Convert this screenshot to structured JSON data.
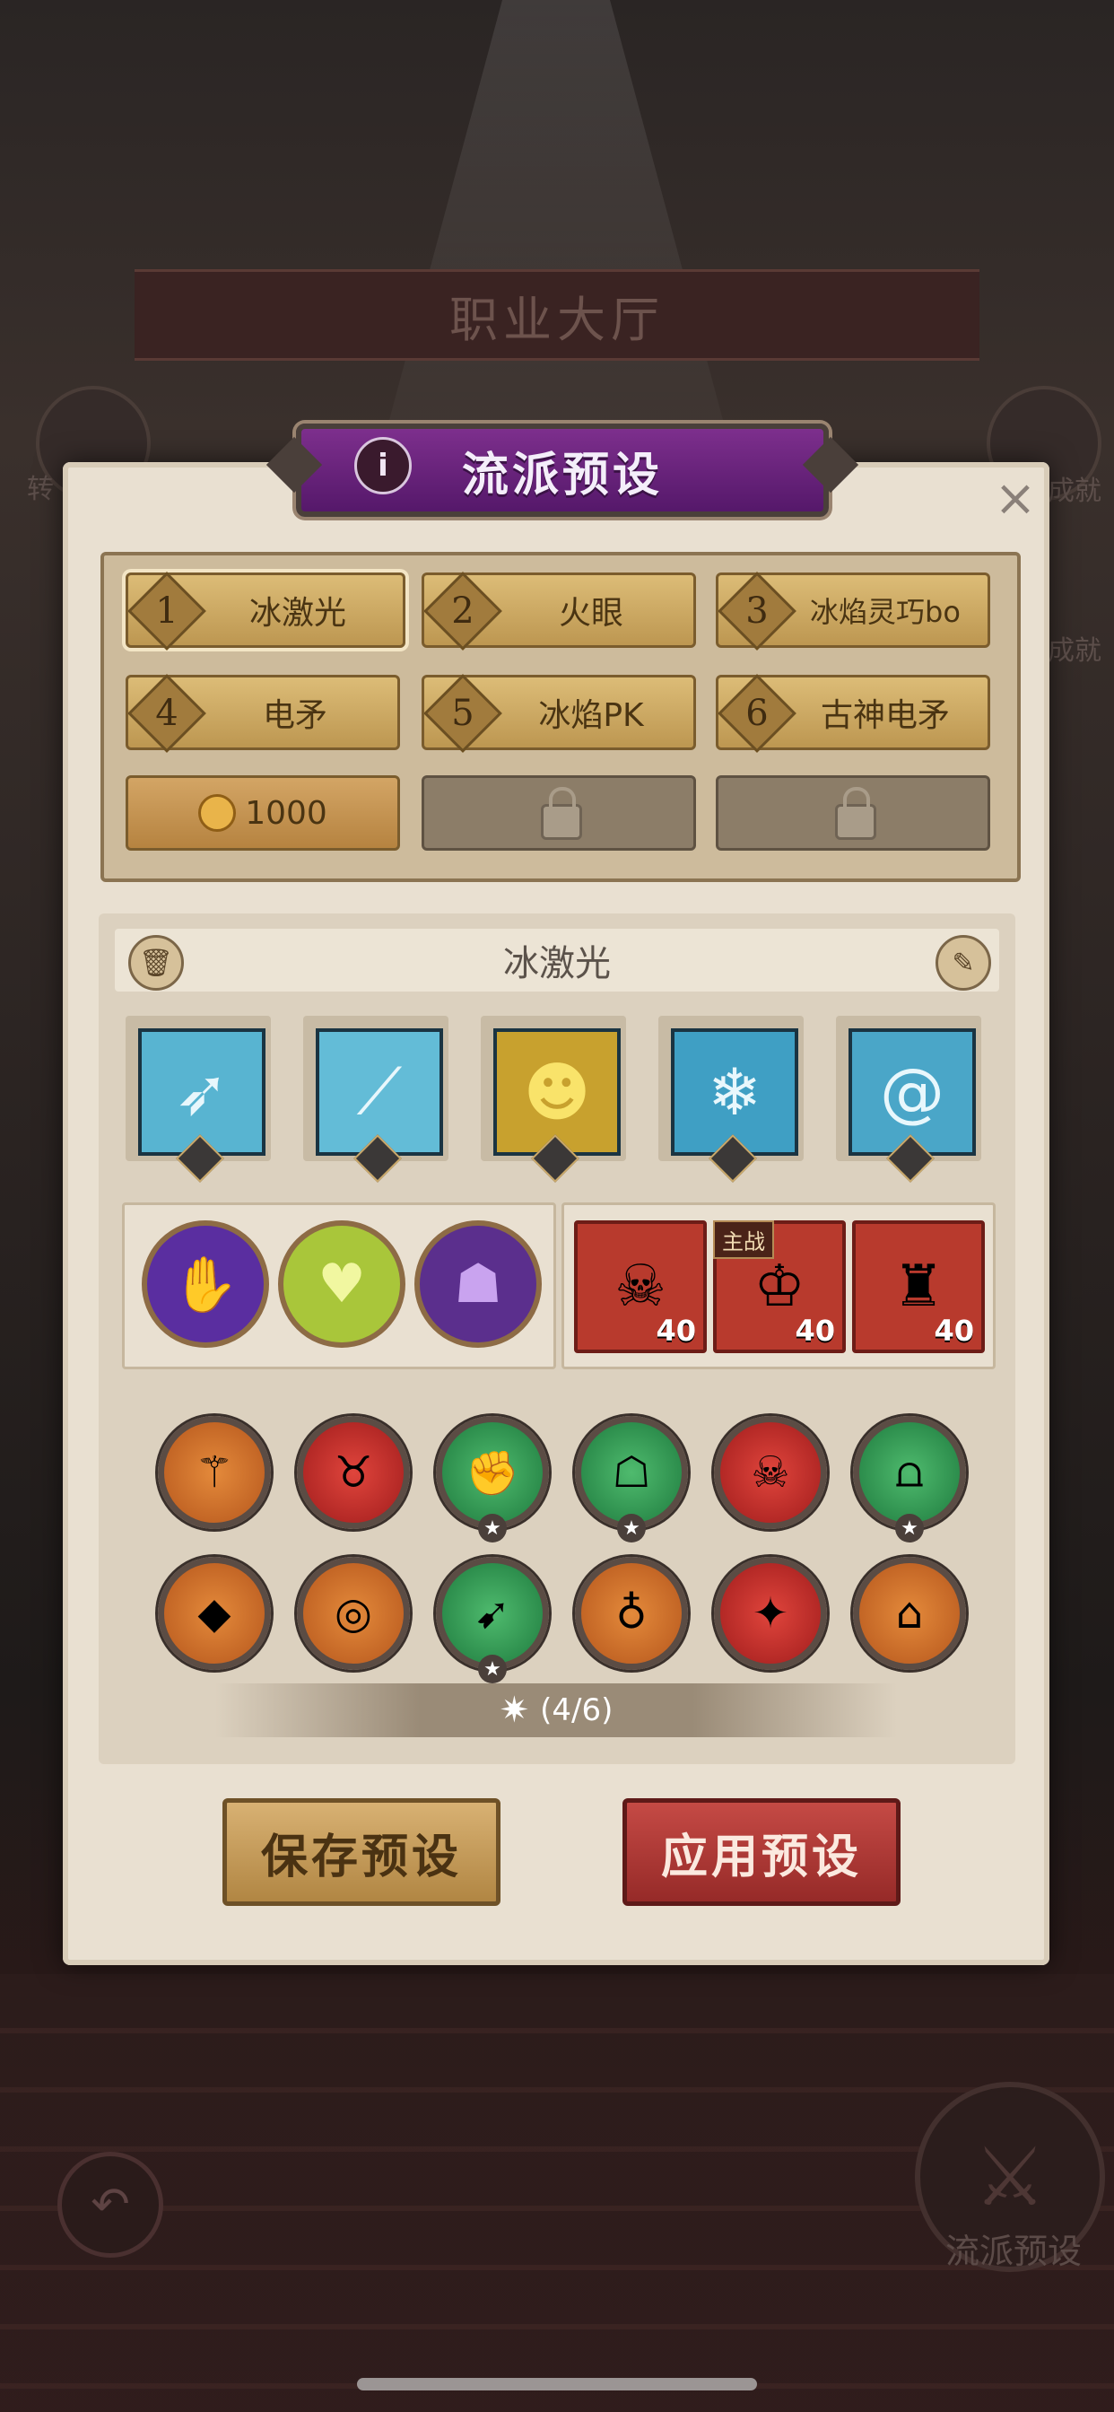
{
  "background": {
    "hall_title": "职业大厅",
    "left_side_label": "转",
    "right_side_labels": [
      "成就",
      "成就"
    ],
    "preset_corner_label": "流派预设"
  },
  "modal": {
    "title": "流派预设",
    "info_icon": "info-icon",
    "close_icon": "close-icon"
  },
  "slots": [
    {
      "num": "1",
      "name": "冰激光",
      "active": true
    },
    {
      "num": "2",
      "name": "火眼"
    },
    {
      "num": "3",
      "name": "冰焰灵巧bo"
    },
    {
      "num": "4",
      "name": "电矛"
    },
    {
      "num": "5",
      "name": "冰焰PK"
    },
    {
      "num": "6",
      "name": "古神电矛"
    }
  ],
  "unlock": {
    "cost": "1000",
    "icon": "coin-icon"
  },
  "locked_slots": 2,
  "preset": {
    "name": "冰激光",
    "delete_icon": "trash-icon",
    "edit_icon": "pencil-icon"
  },
  "skills": [
    {
      "icon": "ice-spear-icon",
      "color": "#58b4d1"
    },
    {
      "icon": "ice-slash-icon",
      "color": "#63bcd7"
    },
    {
      "icon": "golden-figure-icon",
      "color": "#c8a12e"
    },
    {
      "icon": "snowflake-icon",
      "color": "#3f9fc4"
    },
    {
      "icon": "ice-vortex-icon",
      "color": "#4aa6c8"
    }
  ],
  "talents": [
    {
      "icon": "purple-hand-icon",
      "color": "#5a2ea0"
    },
    {
      "icon": "green-heart-icon",
      "color": "#a9c63a"
    },
    {
      "icon": "hooded-figure-icon",
      "color": "#5b2f8d"
    }
  ],
  "heroes": [
    {
      "level": "40",
      "icon": "white-mask-hero-icon"
    },
    {
      "level": "40",
      "icon": "dark-king-hero-icon",
      "tag": "主战"
    },
    {
      "level": "40",
      "icon": "purple-knight-hero-icon"
    }
  ],
  "equipment_row1": [
    {
      "color": "orange",
      "icon": "staff-icon"
    },
    {
      "color": "red",
      "icon": "horned-helm-icon"
    },
    {
      "color": "green",
      "icon": "gauntlet-icon",
      "star": "★"
    },
    {
      "color": "green",
      "icon": "cloak-icon",
      "star": "★"
    },
    {
      "color": "red",
      "icon": "skull-mask-icon"
    },
    {
      "color": "green",
      "icon": "pants-icon",
      "star": "★"
    }
  ],
  "equipment_row2": [
    {
      "color": "orange",
      "icon": "crystal-icon"
    },
    {
      "color": "orange",
      "icon": "ring-icon"
    },
    {
      "color": "green",
      "icon": "crossbow-icon",
      "star": "★"
    },
    {
      "color": "orange",
      "icon": "amulet-icon"
    },
    {
      "color": "red",
      "icon": "star-gem-icon"
    },
    {
      "color": "orange",
      "icon": "boot-icon"
    }
  ],
  "set_bonus": {
    "icon": "star-icon",
    "text": "(4/6)"
  },
  "buttons": {
    "save": "保存预设",
    "apply": "应用预设"
  }
}
